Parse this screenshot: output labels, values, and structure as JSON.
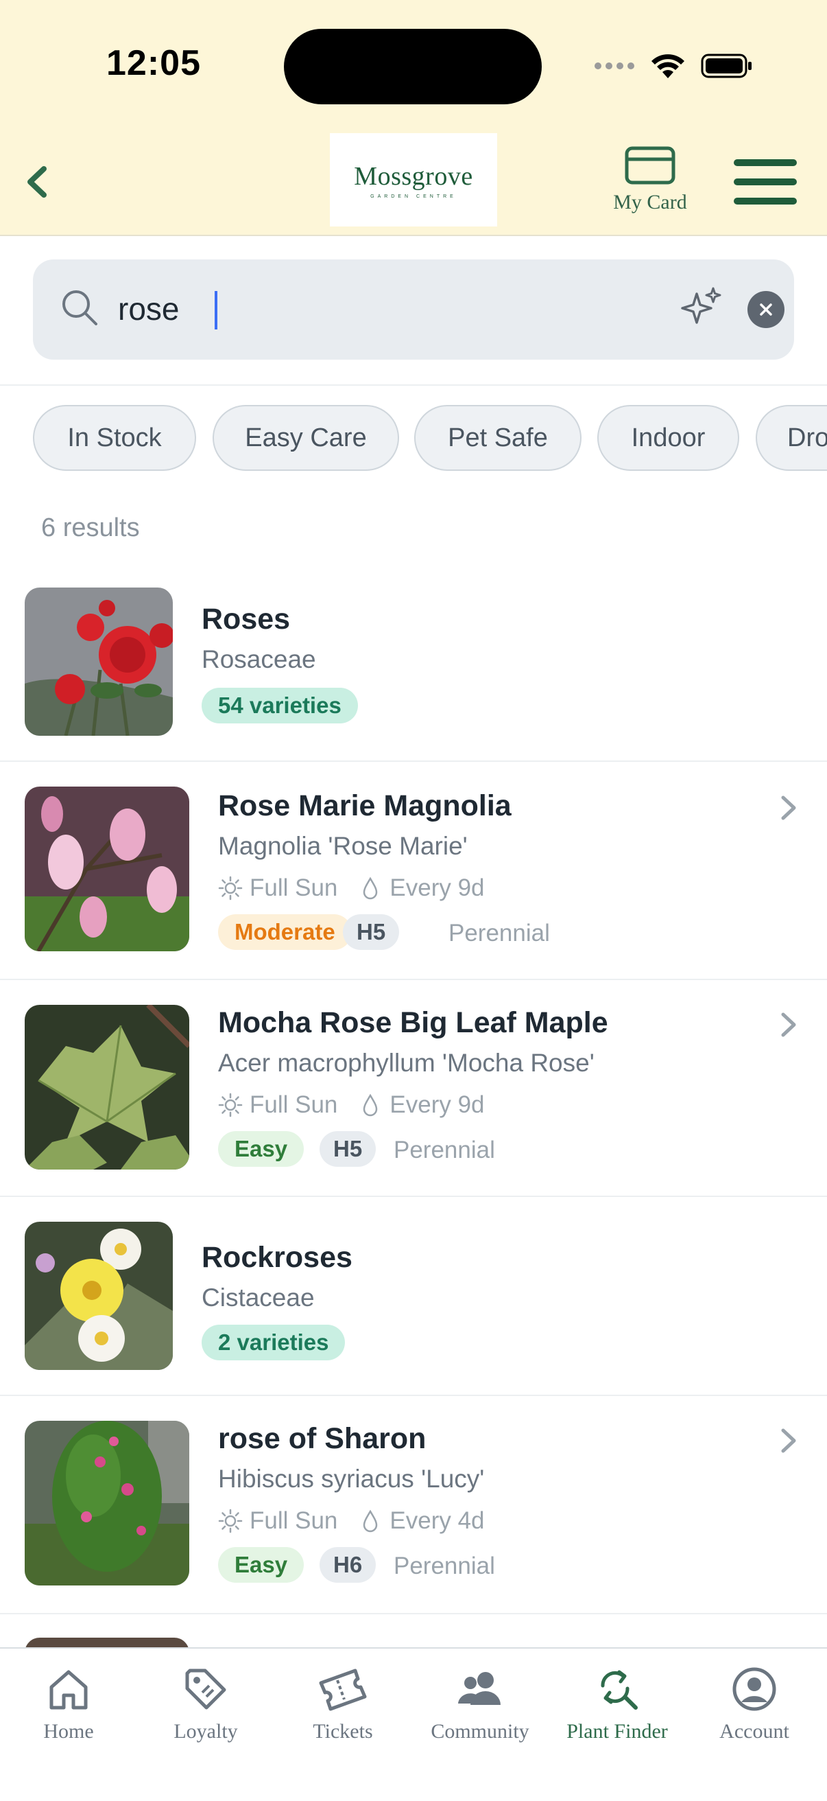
{
  "status_bar": {
    "time": "12:05"
  },
  "header": {
    "logo_text": "Mossgrove",
    "logo_tagline": "GARDEN CENTRE",
    "my_card_label": "My Card"
  },
  "search": {
    "value": "rose",
    "placeholder": ""
  },
  "filters": [
    "In Stock",
    "Easy Care",
    "Pet Safe",
    "Indoor",
    "Dro"
  ],
  "results_count": "6 results",
  "results": [
    {
      "title": "Roses",
      "subtitle": "Rosaceae",
      "badge": "54 varieties"
    },
    {
      "title": "Rose Marie Magnolia",
      "subtitle": "Magnolia 'Rose Marie'",
      "sun": "Full Sun",
      "water": "Every 9d",
      "difficulty": "Moderate",
      "hardiness": "H5",
      "lifecycle": "Perennial"
    },
    {
      "title": "Mocha Rose Big Leaf Maple",
      "subtitle": "Acer macrophyllum 'Mocha Rose'",
      "sun": "Full Sun",
      "water": "Every 9d",
      "difficulty": "Easy",
      "hardiness": "H5",
      "lifecycle": "Perennial"
    },
    {
      "title": "Rockroses",
      "subtitle": "Cistaceae",
      "badge": "2 varieties"
    },
    {
      "title": "rose of Sharon",
      "subtitle": "Hibiscus syriacus 'Lucy'",
      "sun": "Full Sun",
      "water": "Every 4d",
      "difficulty": "Easy",
      "hardiness": "H6",
      "lifecycle": "Perennial"
    }
  ],
  "tabs": [
    {
      "label": "Home",
      "icon": "home-icon"
    },
    {
      "label": "Loyalty",
      "icon": "tag-icon"
    },
    {
      "label": "Tickets",
      "icon": "ticket-icon"
    },
    {
      "label": "Community",
      "icon": "people-icon"
    },
    {
      "label": "Plant Finder",
      "icon": "plant-search-icon",
      "active": true
    },
    {
      "label": "Account",
      "icon": "account-icon"
    }
  ],
  "colors": {
    "header_bg": "#fdf6d8",
    "brand_green": "#1f5c3a",
    "active_tab": "#2e6b4b",
    "caret": "#3b6ef5"
  }
}
